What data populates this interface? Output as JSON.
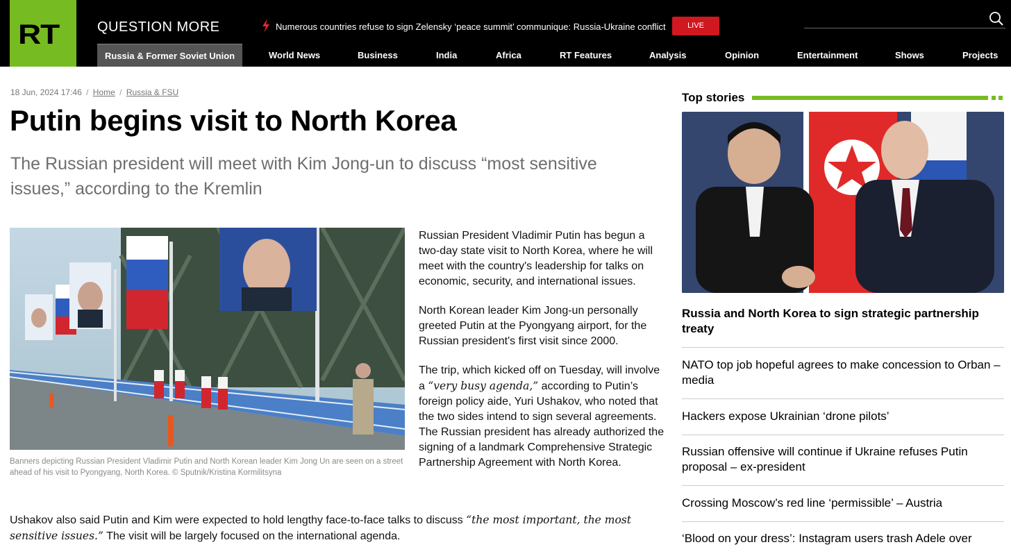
{
  "header": {
    "logo": "RT",
    "tagline": "QUESTION MORE",
    "ticker": "Numerous countries refuse to sign Zelensky ‘peace summit’ communique: Russia-Ukraine conflict",
    "live_label": "LIVE",
    "accent": "#77bb22",
    "live_color": "#d01820",
    "icons": [
      "lightning-icon",
      "search-icon"
    ]
  },
  "nav": {
    "items": [
      {
        "label": "Russia & Former Soviet Union"
      },
      {
        "label": "World News"
      },
      {
        "label": "Business"
      },
      {
        "label": "India"
      },
      {
        "label": "Africa"
      },
      {
        "label": "RT Features"
      },
      {
        "label": "Analysis"
      },
      {
        "label": "Opinion"
      },
      {
        "label": "Entertainment"
      },
      {
        "label": "Shows"
      },
      {
        "label": "Projects"
      }
    ]
  },
  "article": {
    "date": "18 Jun, 2024 17:46",
    "breadcrumb": [
      "Home",
      "Russia & FSU"
    ],
    "breadcrumb_sep": "/",
    "title": "Putin begins visit to North Korea",
    "summary": "The Russian president will meet with Kim Jong-un to discuss “most sensitive issues,” according to the Kremlin",
    "caption": "Banners depicting Russian President Vladimir Putin and North Korean leader Kim Jong Un are seen on a street ahead of his visit to Pyongyang, North Korea. ©  Sputnik/Kristina Kormilitsyna",
    "p1": "Russian President Vladimir Putin has begun a two-day state visit to North Korea, where he will meet with the country's leadership for talks on economic, security, and international issues.",
    "p2": "North Korean leader Kim Jong-un personally greeted Putin at the Pyongyang airport, for the Russian president's first visit since 2000.",
    "p3_a": "The trip, which kicked off on Tuesday, will involve a ",
    "p3_quote": "“very busy agenda,”",
    "p3_b": " according to Putin’s foreign policy aide, Yuri Ushakov, who noted that the two sides intend to sign several agreements. The Russian president has already authorized the signing of a landmark Comprehensive Strategic Partnership Agreement with North Korea.",
    "p4_a": "Ushakov also said Putin and Kim were expected to hold lengthy face-to-face talks to discuss ",
    "p4_quote": "“the most important, the most sensitive issues.”",
    "p4_b": " The visit will be largely focused on the international agenda."
  },
  "sidebar": {
    "title": "Top stories",
    "stories": [
      {
        "title": "Russia and North Korea to sign strategic partnership treaty"
      },
      {
        "title": "NATO top job hopeful agrees to make concession to Orban – media"
      },
      {
        "title": "Hackers expose Ukrainian ‘drone pilots’"
      },
      {
        "title": "Russian offensive will continue if Ukraine refuses Putin proposal – ex-president"
      },
      {
        "title": "Crossing Moscow’s red line ‘permissible’ – Austria"
      },
      {
        "title": "‘Blood on your dress’: Instagram users trash Adele over"
      }
    ]
  }
}
